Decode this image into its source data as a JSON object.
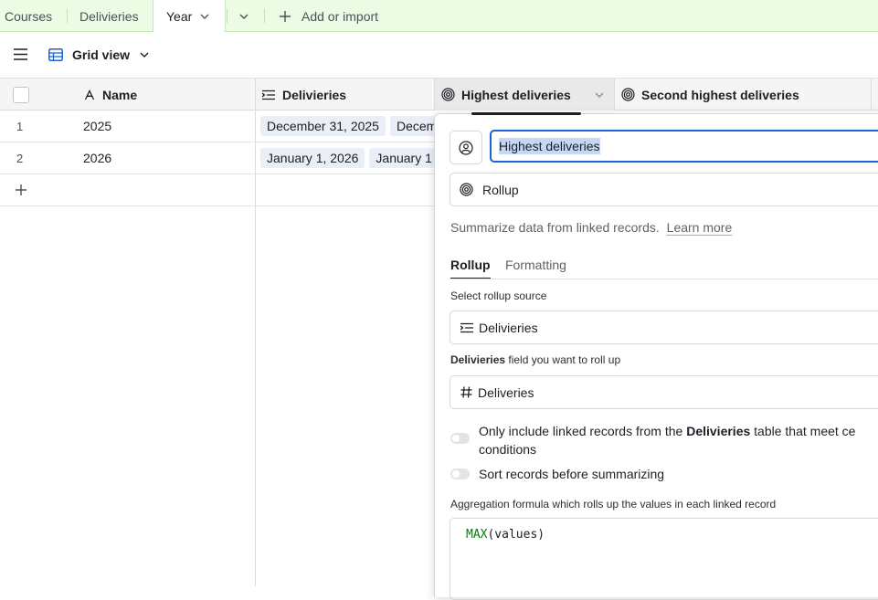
{
  "tabs": {
    "courses": "Courses",
    "deliveries": "Delivieries",
    "year": "Year",
    "add_or_import": "Add or import"
  },
  "toolbar": {
    "view_name": "Grid view"
  },
  "columns": {
    "name": "Name",
    "deliveries": "Delivieries",
    "highest": "Highest deliveries",
    "second_highest": "Second highest deliveries"
  },
  "rows": [
    {
      "num": "1",
      "name": "2025",
      "deliveries": [
        "December 31, 2025",
        "Decem"
      ]
    },
    {
      "num": "2",
      "name": "2026",
      "deliveries": [
        "January 1, 2026",
        "January 1"
      ]
    }
  ],
  "panel": {
    "field_name_value": "Highest deliveries",
    "field_type": "Rollup",
    "description": "Summarize data from linked records.",
    "learn_more": "Learn more",
    "tab_rollup": "Rollup",
    "tab_formatting": "Formatting",
    "rollup_source_label": "Select rollup source",
    "rollup_source_value": "Delivieries",
    "rollup_field_label_bold": "Delivieries",
    "rollup_field_label_rest": " field you want to roll up",
    "rollup_field_value": "Deliveries",
    "condition_prefix": "Only include linked records from the ",
    "condition_bold": "Delivieries",
    "condition_suffix": " table that meet ce",
    "condition_line2": "conditions",
    "sort_label": "Sort records before summarizing",
    "aggregation_label": "Aggregation formula which rolls up the values in each linked record",
    "formula_fn": "MAX",
    "formula_args": "(values)"
  },
  "colors": {
    "tabbar_bg": "#ebfbe4",
    "selection": "#c4d8f5",
    "focus_border": "#1a62d6",
    "formula_green": "#0a7a16",
    "pill_bg": "#e9eef7"
  },
  "icons": {
    "view": "grid-view-icon",
    "name_field": "text-a-icon",
    "link_field": "linked-records-icon",
    "rollup_field": "rollup-spiral-icon",
    "number_field": "hash-icon"
  }
}
